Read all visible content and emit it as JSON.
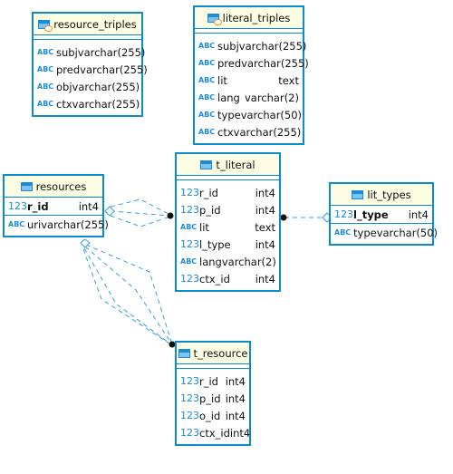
{
  "colors": {
    "border": "#0b8ccf",
    "header": "#fdfde3",
    "line": "#3aa0d8"
  },
  "tables": {
    "resource_triples": {
      "name": "resource_triples",
      "icon": "view-icon",
      "columns": [
        {
          "type_icon": "ABC",
          "name": "subj",
          "type": "varchar(255)"
        },
        {
          "type_icon": "ABC",
          "name": "pred",
          "type": "varchar(255)"
        },
        {
          "type_icon": "ABC",
          "name": "obj",
          "type": "varchar(255)"
        },
        {
          "type_icon": "ABC",
          "name": "ctx",
          "type": "varchar(255)"
        }
      ]
    },
    "literal_triples": {
      "name": "literal_triples",
      "icon": "view-icon",
      "columns": [
        {
          "type_icon": "ABC",
          "name": "subj",
          "type": "varchar(255)"
        },
        {
          "type_icon": "ABC",
          "name": "pred",
          "type": "varchar(255)"
        },
        {
          "type_icon": "ABC",
          "name": "lit",
          "type": "text"
        },
        {
          "type_icon": "ABC",
          "name": "lang",
          "type": "varchar(2)"
        },
        {
          "type_icon": "ABC",
          "name": "type",
          "type": "varchar(50)"
        },
        {
          "type_icon": "ABC",
          "name": "ctx",
          "type": "varchar(255)"
        }
      ]
    },
    "resources": {
      "name": "resources",
      "icon": "table-icon",
      "pk": [
        {
          "type_icon": "123",
          "name": "r_id",
          "type": "int4"
        }
      ],
      "columns": [
        {
          "type_icon": "ABC",
          "name": "uri",
          "type": "varchar(255)"
        }
      ]
    },
    "t_literal": {
      "name": "t_literal",
      "icon": "table-icon",
      "columns": [
        {
          "type_icon": "123",
          "name": "r_id",
          "type": "int4"
        },
        {
          "type_icon": "123",
          "name": "p_id",
          "type": "int4"
        },
        {
          "type_icon": "ABC",
          "name": "lit",
          "type": "text"
        },
        {
          "type_icon": "123",
          "name": "l_type",
          "type": "int4"
        },
        {
          "type_icon": "ABC",
          "name": "lang",
          "type": "varchar(2)"
        },
        {
          "type_icon": "123",
          "name": "ctx_id",
          "type": "int4"
        }
      ]
    },
    "lit_types": {
      "name": "lit_types",
      "icon": "table-icon",
      "pk": [
        {
          "type_icon": "123",
          "name": "l_type",
          "type": "int4"
        }
      ],
      "columns": [
        {
          "type_icon": "ABC",
          "name": "type",
          "type": "varchar(50)"
        }
      ]
    },
    "t_resource": {
      "name": "t_resource",
      "icon": "table-icon",
      "columns": [
        {
          "type_icon": "123",
          "name": "r_id",
          "type": "int4"
        },
        {
          "type_icon": "123",
          "name": "p_id",
          "type": "int4"
        },
        {
          "type_icon": "123",
          "name": "o_id",
          "type": "int4"
        },
        {
          "type_icon": "123",
          "name": "ctx_id",
          "type": "int4"
        }
      ]
    }
  }
}
